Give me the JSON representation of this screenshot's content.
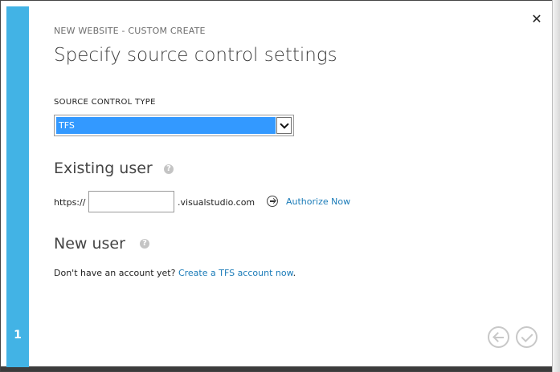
{
  "wizard": {
    "eyebrow": "NEW WEBSITE - CUSTOM CREATE",
    "title": "Specify source control settings",
    "step": "1",
    "close_icon": "close-icon"
  },
  "source_control": {
    "label": "SOURCE CONTROL TYPE",
    "selected": "TFS"
  },
  "existing_user": {
    "title": "Existing user",
    "help_icon": "question-icon",
    "prefix": "https://",
    "input_value": "",
    "suffix": ".visualstudio.com",
    "authorize_label": "Authorize Now"
  },
  "new_user": {
    "title": "New user",
    "help_icon": "question-icon",
    "text": "Don't have an account yet?",
    "link": "Create a TFS account now",
    "end": "."
  },
  "navigation": {
    "back_icon": "back-arrow-icon",
    "finish_icon": "checkmark-icon"
  },
  "colors": {
    "accent": "#42b3e5",
    "link": "#1a7bb8",
    "selection": "#3399ff"
  }
}
